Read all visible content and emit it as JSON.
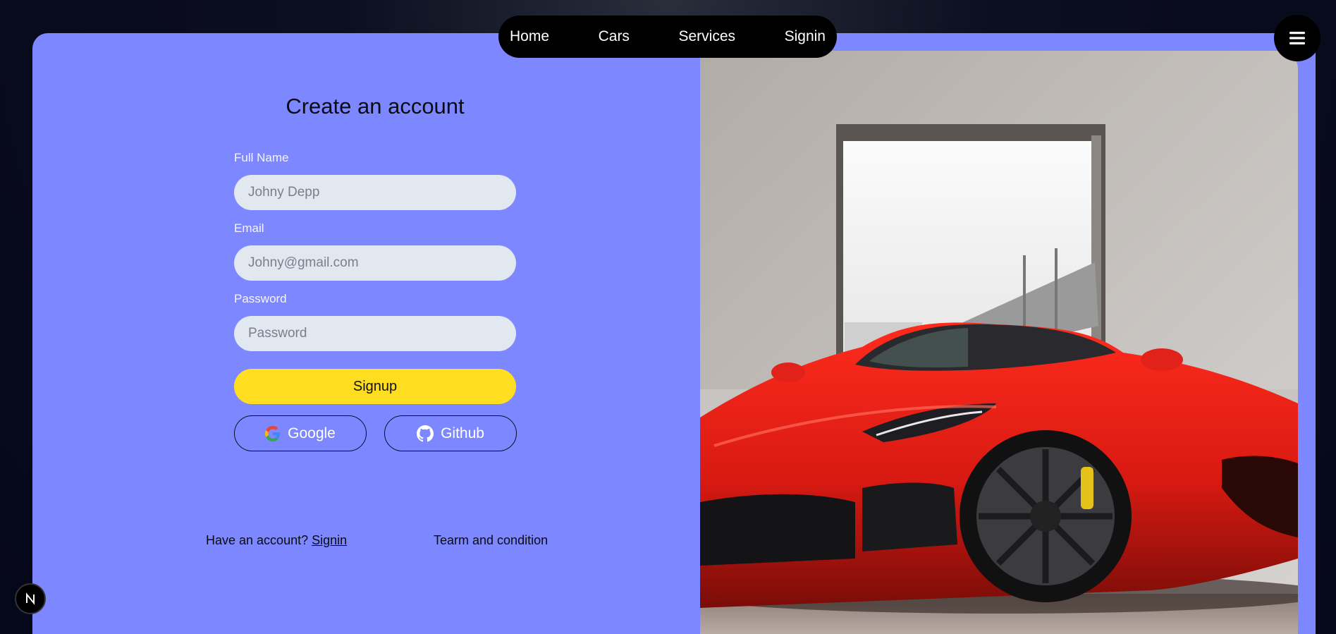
{
  "nav": {
    "items": [
      {
        "label": "Home"
      },
      {
        "label": "Cars"
      },
      {
        "label": "Services"
      },
      {
        "label": "Signin"
      }
    ],
    "menu_icon": "hamburger-icon"
  },
  "form": {
    "title": "Create an account",
    "full_name": {
      "label": "Full Name",
      "placeholder": "Johny Depp",
      "value": ""
    },
    "email": {
      "label": "Email",
      "placeholder": "Johny@gmail.com",
      "value": ""
    },
    "password": {
      "label": "Password",
      "placeholder": "Password",
      "value": ""
    },
    "signup_label": "Signup",
    "google_label": "Google",
    "github_label": "Github"
  },
  "footer": {
    "have_account": "Have an account?",
    "signin_link": "Signin",
    "terms": "Tearm and condition"
  },
  "colors": {
    "card": "#7d87ff",
    "signup_button": "#ffde22",
    "input_bg": "#e2e8f0",
    "car_red": "#d81a12"
  },
  "hero_image": "red-sports-car-in-garage"
}
